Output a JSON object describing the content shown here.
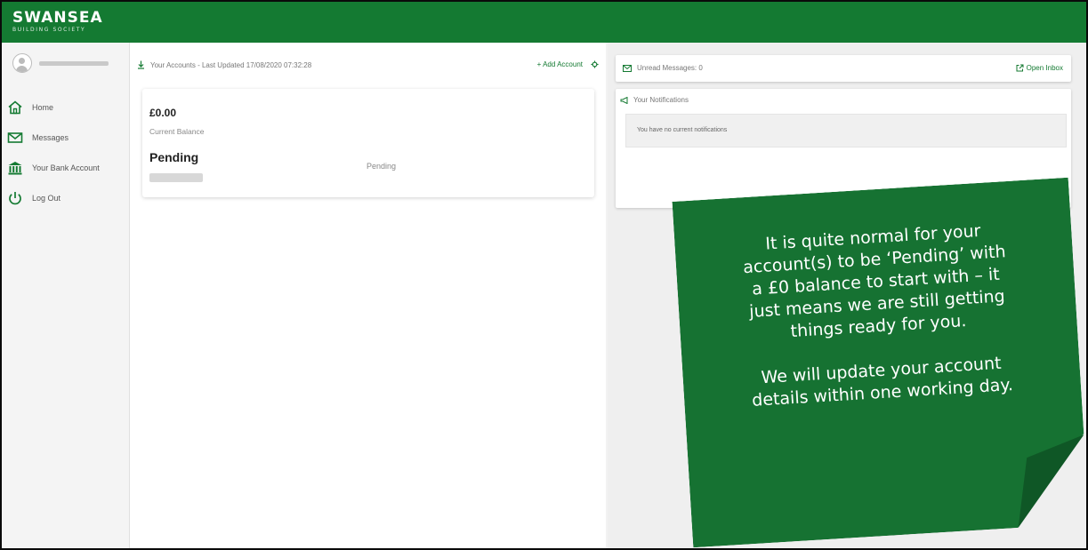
{
  "brand": {
    "name": "SWANSEA",
    "subtitle": "BUILDING SOCIETY"
  },
  "nav": {
    "items": [
      {
        "label": "Home",
        "icon": "home-icon"
      },
      {
        "label": "Messages",
        "icon": "envelope-icon"
      },
      {
        "label": "Your Bank Account",
        "icon": "bank-icon"
      },
      {
        "label": "Log Out",
        "icon": "power-icon"
      }
    ]
  },
  "accounts": {
    "title": "Your Accounts - Last Updated 17/08/2020 07:32:28",
    "add_label": "+ Add Account",
    "card": {
      "balance": "£0.00",
      "balance_label": "Current Balance",
      "status": "Pending",
      "status_right": "Pending"
    }
  },
  "messages": {
    "unread_label": "Unread Messages: 0",
    "open_inbox_label": "Open Inbox"
  },
  "notifications": {
    "title": "Your Notifications",
    "empty_text": "You have no current notifications"
  },
  "note": {
    "lines_top": [
      "It is quite normal for your",
      "account(s) to be ‘Pending’ with",
      "a £0 balance to start with – it",
      "just means we are still getting",
      "things ready for you."
    ],
    "lines_bottom": [
      "We will update your account",
      "details within one working day."
    ]
  },
  "colors": {
    "brand_green": "#147a32",
    "note_green": "#167232"
  }
}
